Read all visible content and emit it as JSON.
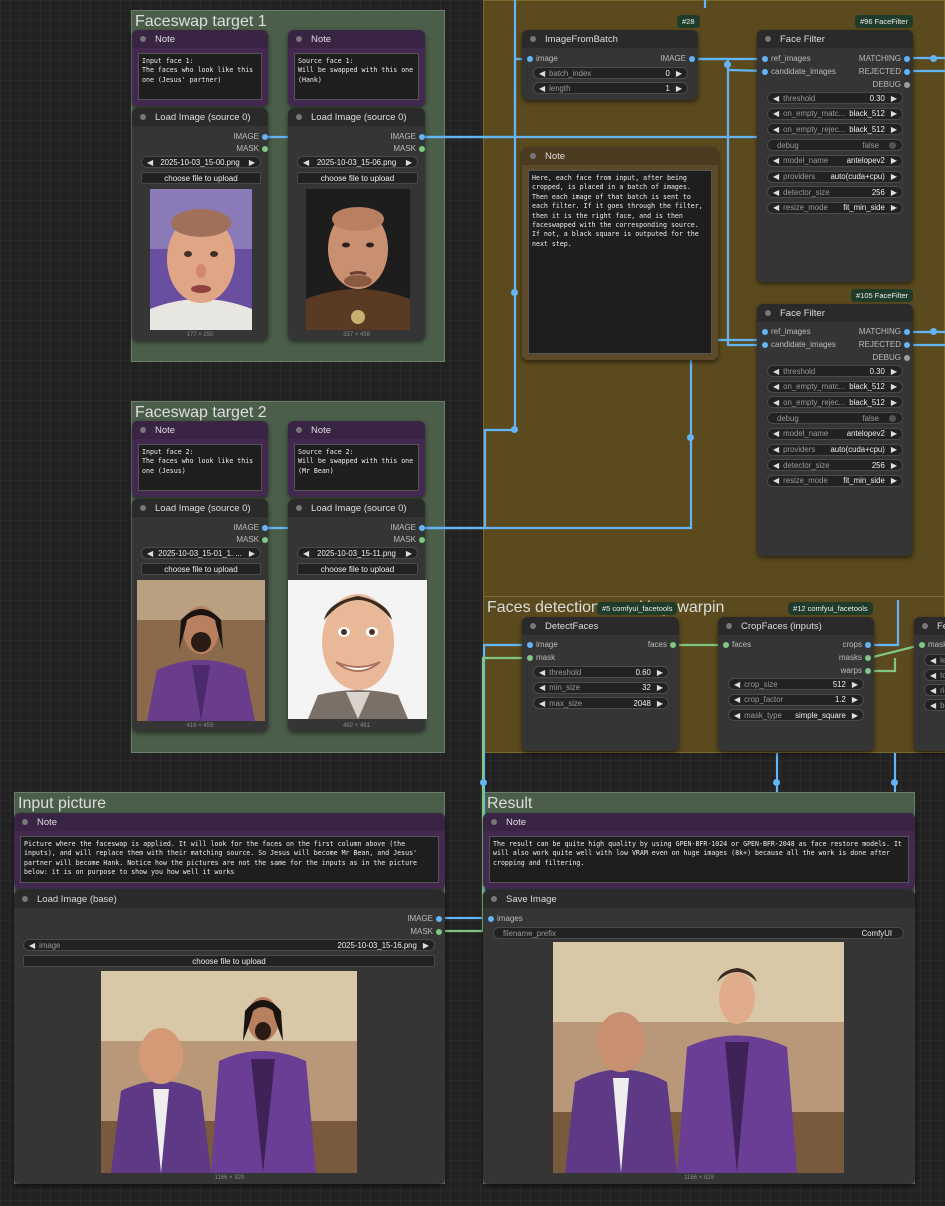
{
  "groups": {
    "faceswap1": "Faceswap target 1",
    "faceswap2": "Faceswap target 2",
    "input_picture": "Input picture",
    "result": "Result",
    "faces_detection": "Faces detection, masking, warpin"
  },
  "badges": {
    "image_from_batch": "#28",
    "face_filter_1": "#96 FaceFilter",
    "face_filter_2": "#105 FaceFilter",
    "detect_faces": "#5 comfyui_facetools",
    "crop_faces": "#12 comfyui_facetools"
  },
  "note_title": "Note",
  "load_image_source_title": "Load Image (source 0)",
  "load_image_base_title": "Load Image (base)",
  "slots": {
    "image_out": "IMAGE",
    "mask_out": "MASK",
    "image_in": "image",
    "images_in": "images",
    "mask_in": "mask",
    "faces_in": "faces",
    "faces_out": "faces",
    "ref_images": "ref_images",
    "candidate_images": "candidate_images",
    "matching": "MATCHING",
    "rejected": "REJECTED",
    "debug": "DEBUG",
    "crops": "crops",
    "masks": "masks",
    "warps": "warps"
  },
  "upload_label": "choose file to upload",
  "notes": {
    "target1_input": "Input face 1:\nThe faces who look like this one (Jesus' partner)",
    "target1_source": "Source face 1:\nWill be swapped with this one (Hank)",
    "target2_input": "Input face 2:\nThe faces who look like this one (Jesus)",
    "target2_source": "Source face 2:\nWill be swapped with this one (Mr Bean)",
    "batch_note": "Here, each face from input, after being cropped, is placed in a batch of images. Then each image of that batch is sent to each filter. If it goes through the filter, then it is the right face, and is then faceswapped with the corresponding source. If not, a black square is outputed for the next step.",
    "input_picture": "Picture where the faceswap is applied. It will look for the faces on the first column above (the inputs), and will replace them with their matching source. So Jesus will become Mr Bean, and Jesus' partner will become Hank. Notice how the pictures are not the same for the inputs as in the picture below: it is on purpose to show you how well it works",
    "result": "The result can be quite high quality by using GPEN-BFR-1024 or GPEN-BFR-2048 as face restore models. It will also work quite well with low VRAM even on huge images (8k+) because all the work is done after cropping and filtering."
  },
  "load_images": {
    "t1_input": {
      "file": "2025-10-03_15-00.png",
      "size": "177 × 250"
    },
    "t1_source": {
      "file": "2025-10-03_15-06.png",
      "size": "337 × 458"
    },
    "t2_input": {
      "file": "2025-10-03_15-01_1. ...",
      "size": "416 × 459"
    },
    "t2_source": {
      "file": "2025-10-03_15-11.png",
      "size": "492 × 491"
    },
    "base": {
      "label": "image",
      "file": "2025-10-03_15-16.png",
      "size": "1166 × 929"
    }
  },
  "image_from_batch": {
    "title": "ImageFromBatch",
    "batch_index_label": "batch_index",
    "batch_index": "0",
    "length_label": "length",
    "length": "1"
  },
  "face_filter": {
    "title": "Face Filter",
    "widgets": [
      {
        "label": "threshold",
        "value": "0.30"
      },
      {
        "label": "on_empty_matc...",
        "value": "black_512"
      },
      {
        "label": "on_empty_rejec...",
        "value": "black_512"
      },
      {
        "label": "debug",
        "value": "false"
      },
      {
        "label": "model_name",
        "value": "antelopev2"
      },
      {
        "label": "providers",
        "value": "auto(cuda+cpu)"
      },
      {
        "label": "detector_size",
        "value": "256"
      },
      {
        "label": "resize_mode",
        "value": "fit_min_side"
      }
    ]
  },
  "detect_faces": {
    "title": "DetectFaces",
    "widgets": [
      {
        "label": "threshold",
        "value": "0.60"
      },
      {
        "label": "min_size",
        "value": "32"
      },
      {
        "label": "max_size",
        "value": "2048"
      }
    ]
  },
  "crop_faces": {
    "title": "CropFaces (inputs)",
    "widgets": [
      {
        "label": "crop_size",
        "value": "512"
      },
      {
        "label": "crop_factor",
        "value": "1.2"
      },
      {
        "label": "mask_type",
        "value": "simple_square"
      }
    ]
  },
  "partial_node": {
    "title": "Fe",
    "slot": "mask",
    "w1": "lef",
    "w2": "top",
    "w3": "rig",
    "w4": "bo"
  },
  "save_image": {
    "title": "Save Image",
    "prefix_label": "filename_prefix",
    "prefix_value": "ComfyUI",
    "size": "1166 × 929"
  },
  "colors": {
    "image_link": "#64b5f6",
    "mask_link": "#81c784",
    "group_green": "#4b5e4a",
    "group_brown": "#5b4a1e",
    "note_purple": "#432950"
  }
}
